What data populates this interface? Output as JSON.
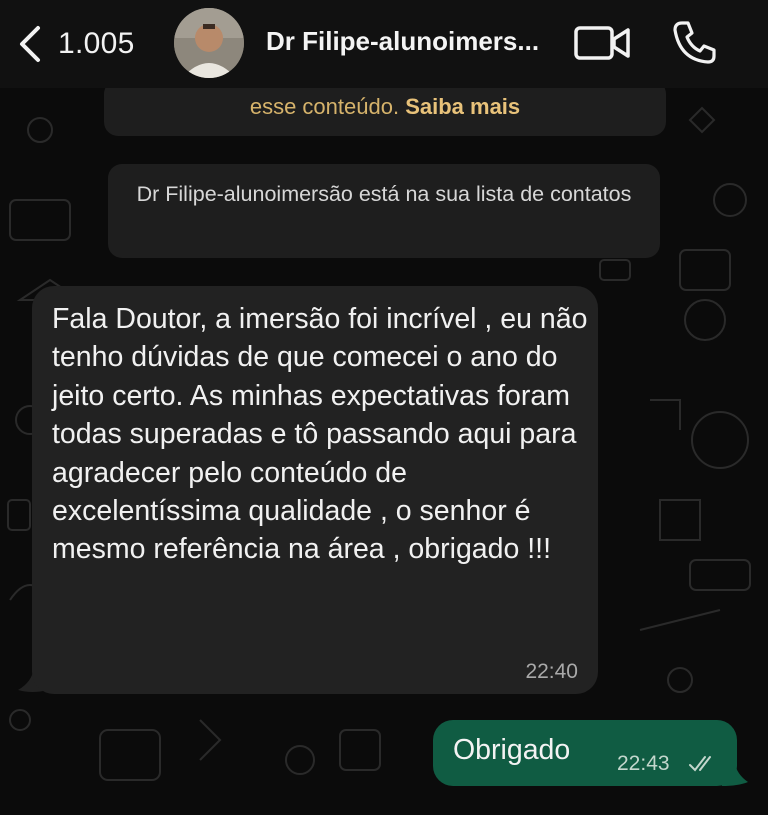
{
  "header": {
    "back_count": "1.005",
    "contact_name": "Dr Filipe-alunoimers...",
    "icons": [
      "chevron-left-icon",
      "video-camera-icon",
      "phone-icon"
    ]
  },
  "notices": {
    "privacy_text": "esse conteúdo.",
    "privacy_link": "Saiba mais",
    "contact_notice": "Dr Filipe-alunoimersão está na sua lista de contatos"
  },
  "messages": {
    "incoming": {
      "text": "Fala Doutor, a imersão foi incrível , eu não tenho dúvidas de que comecei o ano do jeito certo. As minhas expectativas foram todas superadas e tô passando aqui para agradecer pelo conteúdo de excelentíssima qualidade , o senhor é mesmo referência na área , obrigado !!!",
      "time": "22:40"
    },
    "outgoing": {
      "text": "Obrigado",
      "time": "22:43",
      "status_icon": "double-check-icon"
    }
  },
  "colors": {
    "background": "#0b0b0b",
    "incoming_bubble": "#222222",
    "outgoing_bubble": "#105c43",
    "link_accent": "#e8c27a"
  }
}
